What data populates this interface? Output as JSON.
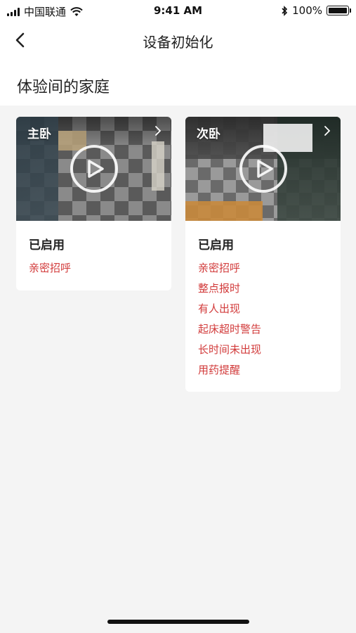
{
  "status_bar": {
    "carrier": "中国联通",
    "time": "9:41 AM",
    "battery": "100%"
  },
  "nav": {
    "title": "设备初始化"
  },
  "section": {
    "title": "体验间的家庭"
  },
  "cards": [
    {
      "camera_name": "主卧",
      "status": "已启用",
      "features": [
        "亲密招呼"
      ]
    },
    {
      "camera_name": "次卧",
      "status": "已启用",
      "features": [
        "亲密招呼",
        "整点报时",
        "有人出现",
        "起床超时警告",
        "长时间未出现",
        "用药提醒"
      ]
    }
  ],
  "colors": {
    "accent_red": "#d23b3b",
    "background": "#f4f4f4"
  }
}
